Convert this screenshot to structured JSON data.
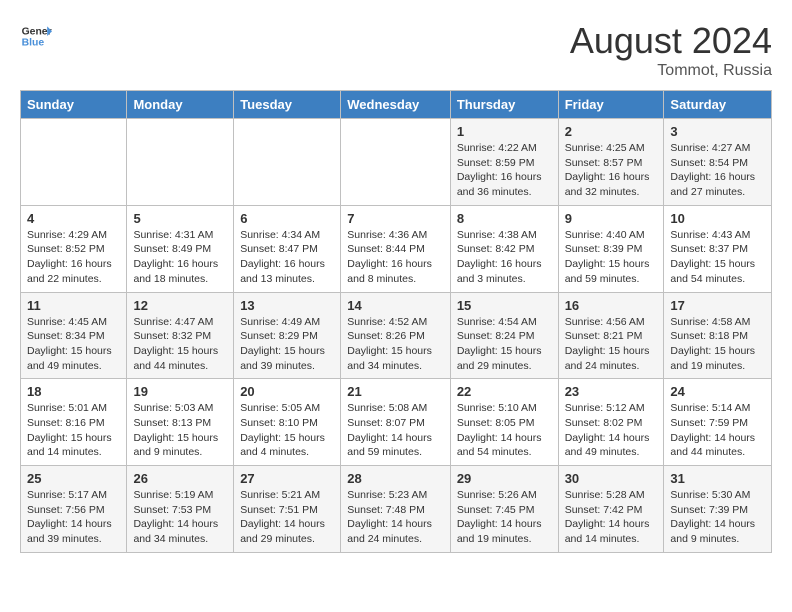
{
  "header": {
    "logo_line1": "General",
    "logo_line2": "Blue",
    "month": "August 2024",
    "location": "Tommot, Russia"
  },
  "weekdays": [
    "Sunday",
    "Monday",
    "Tuesday",
    "Wednesday",
    "Thursday",
    "Friday",
    "Saturday"
  ],
  "weeks": [
    [
      {
        "day": "",
        "content": ""
      },
      {
        "day": "",
        "content": ""
      },
      {
        "day": "",
        "content": ""
      },
      {
        "day": "",
        "content": ""
      },
      {
        "day": "1",
        "content": "Sunrise: 4:22 AM\nSunset: 8:59 PM\nDaylight: 16 hours\nand 36 minutes."
      },
      {
        "day": "2",
        "content": "Sunrise: 4:25 AM\nSunset: 8:57 PM\nDaylight: 16 hours\nand 32 minutes."
      },
      {
        "day": "3",
        "content": "Sunrise: 4:27 AM\nSunset: 8:54 PM\nDaylight: 16 hours\nand 27 minutes."
      }
    ],
    [
      {
        "day": "4",
        "content": "Sunrise: 4:29 AM\nSunset: 8:52 PM\nDaylight: 16 hours\nand 22 minutes."
      },
      {
        "day": "5",
        "content": "Sunrise: 4:31 AM\nSunset: 8:49 PM\nDaylight: 16 hours\nand 18 minutes."
      },
      {
        "day": "6",
        "content": "Sunrise: 4:34 AM\nSunset: 8:47 PM\nDaylight: 16 hours\nand 13 minutes."
      },
      {
        "day": "7",
        "content": "Sunrise: 4:36 AM\nSunset: 8:44 PM\nDaylight: 16 hours\nand 8 minutes."
      },
      {
        "day": "8",
        "content": "Sunrise: 4:38 AM\nSunset: 8:42 PM\nDaylight: 16 hours\nand 3 minutes."
      },
      {
        "day": "9",
        "content": "Sunrise: 4:40 AM\nSunset: 8:39 PM\nDaylight: 15 hours\nand 59 minutes."
      },
      {
        "day": "10",
        "content": "Sunrise: 4:43 AM\nSunset: 8:37 PM\nDaylight: 15 hours\nand 54 minutes."
      }
    ],
    [
      {
        "day": "11",
        "content": "Sunrise: 4:45 AM\nSunset: 8:34 PM\nDaylight: 15 hours\nand 49 minutes."
      },
      {
        "day": "12",
        "content": "Sunrise: 4:47 AM\nSunset: 8:32 PM\nDaylight: 15 hours\nand 44 minutes."
      },
      {
        "day": "13",
        "content": "Sunrise: 4:49 AM\nSunset: 8:29 PM\nDaylight: 15 hours\nand 39 minutes."
      },
      {
        "day": "14",
        "content": "Sunrise: 4:52 AM\nSunset: 8:26 PM\nDaylight: 15 hours\nand 34 minutes."
      },
      {
        "day": "15",
        "content": "Sunrise: 4:54 AM\nSunset: 8:24 PM\nDaylight: 15 hours\nand 29 minutes."
      },
      {
        "day": "16",
        "content": "Sunrise: 4:56 AM\nSunset: 8:21 PM\nDaylight: 15 hours\nand 24 minutes."
      },
      {
        "day": "17",
        "content": "Sunrise: 4:58 AM\nSunset: 8:18 PM\nDaylight: 15 hours\nand 19 minutes."
      }
    ],
    [
      {
        "day": "18",
        "content": "Sunrise: 5:01 AM\nSunset: 8:16 PM\nDaylight: 15 hours\nand 14 minutes."
      },
      {
        "day": "19",
        "content": "Sunrise: 5:03 AM\nSunset: 8:13 PM\nDaylight: 15 hours\nand 9 minutes."
      },
      {
        "day": "20",
        "content": "Sunrise: 5:05 AM\nSunset: 8:10 PM\nDaylight: 15 hours\nand 4 minutes."
      },
      {
        "day": "21",
        "content": "Sunrise: 5:08 AM\nSunset: 8:07 PM\nDaylight: 14 hours\nand 59 minutes."
      },
      {
        "day": "22",
        "content": "Sunrise: 5:10 AM\nSunset: 8:05 PM\nDaylight: 14 hours\nand 54 minutes."
      },
      {
        "day": "23",
        "content": "Sunrise: 5:12 AM\nSunset: 8:02 PM\nDaylight: 14 hours\nand 49 minutes."
      },
      {
        "day": "24",
        "content": "Sunrise: 5:14 AM\nSunset: 7:59 PM\nDaylight: 14 hours\nand 44 minutes."
      }
    ],
    [
      {
        "day": "25",
        "content": "Sunrise: 5:17 AM\nSunset: 7:56 PM\nDaylight: 14 hours\nand 39 minutes."
      },
      {
        "day": "26",
        "content": "Sunrise: 5:19 AM\nSunset: 7:53 PM\nDaylight: 14 hours\nand 34 minutes."
      },
      {
        "day": "27",
        "content": "Sunrise: 5:21 AM\nSunset: 7:51 PM\nDaylight: 14 hours\nand 29 minutes."
      },
      {
        "day": "28",
        "content": "Sunrise: 5:23 AM\nSunset: 7:48 PM\nDaylight: 14 hours\nand 24 minutes."
      },
      {
        "day": "29",
        "content": "Sunrise: 5:26 AM\nSunset: 7:45 PM\nDaylight: 14 hours\nand 19 minutes."
      },
      {
        "day": "30",
        "content": "Sunrise: 5:28 AM\nSunset: 7:42 PM\nDaylight: 14 hours\nand 14 minutes."
      },
      {
        "day": "31",
        "content": "Sunrise: 5:30 AM\nSunset: 7:39 PM\nDaylight: 14 hours\nand 9 minutes."
      }
    ]
  ]
}
